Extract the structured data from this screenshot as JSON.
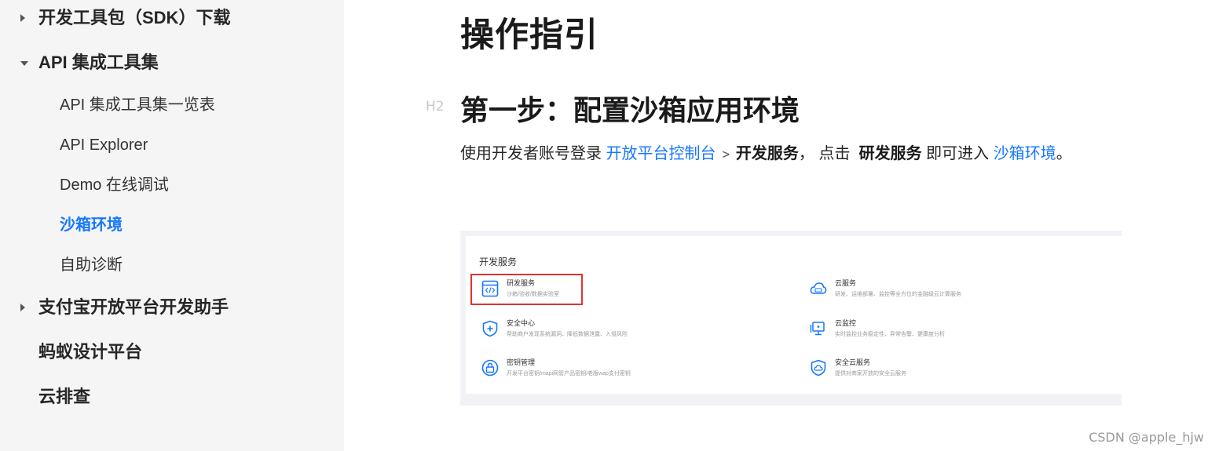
{
  "sidebar": {
    "items": [
      {
        "label": "开发工具包（SDK）下载",
        "level": "top",
        "caret": "right"
      },
      {
        "label": "API 集成工具集",
        "level": "top",
        "caret": "down"
      },
      {
        "label": "API 集成工具集一览表",
        "level": "sub"
      },
      {
        "label": "API Explorer",
        "level": "sub"
      },
      {
        "label": "Demo 在线调试",
        "level": "sub"
      },
      {
        "label": "沙箱环境",
        "level": "sub",
        "active": true
      },
      {
        "label": "自助诊断",
        "level": "sub"
      },
      {
        "label": "支付宝开放平台开发助手",
        "level": "top",
        "caret": "right"
      },
      {
        "label": "蚂蚁设计平台",
        "level": "top"
      },
      {
        "label": "云排查",
        "level": "top"
      }
    ]
  },
  "main": {
    "page_title": "操作指引",
    "heading_marker": "H2",
    "section_title": "第一步：配置沙箱应用环境",
    "paragraph": {
      "t1": "使用开发者账号登录",
      "link1": "开放平台控制台",
      "sep": ">",
      "b1": "开发服务",
      "t2": "， 点击",
      "b2": "研发服务",
      "t3": "即可进入",
      "link2": "沙箱环境",
      "t4": "。"
    },
    "screenshot": {
      "title": "开发服务",
      "services": [
        {
          "name": "研发服务",
          "desc": "沙箱/验收/数据实验室",
          "icon": "code-window-icon"
        },
        {
          "name": "云服务",
          "desc": "研发、运维部署、监控等全方位的金融级云计算服务",
          "icon": "cloud-icon"
        },
        {
          "name": "安全中心",
          "desc": "帮助商户发现系统漏洞、降低数据泄露、入侵风险",
          "icon": "shield-plus-icon"
        },
        {
          "name": "云监控",
          "desc": "实时监控业务稳定性、异常告警、健康度分析",
          "icon": "monitor-icon"
        },
        {
          "name": "密钥管理",
          "desc": "开发平台密钥/mapi网管产品密钥/老版wap支付密钥",
          "icon": "lock-icon"
        },
        {
          "name": "安全云服务",
          "desc": "提供对商家开放的安全云服务",
          "icon": "shield-cloud-icon"
        }
      ]
    }
  },
  "watermark": "CSDN @apple_hjw",
  "colors": {
    "accent": "#1677ff",
    "highlight": "#e0332f",
    "sidebar_bg": "#f5f5f5"
  }
}
